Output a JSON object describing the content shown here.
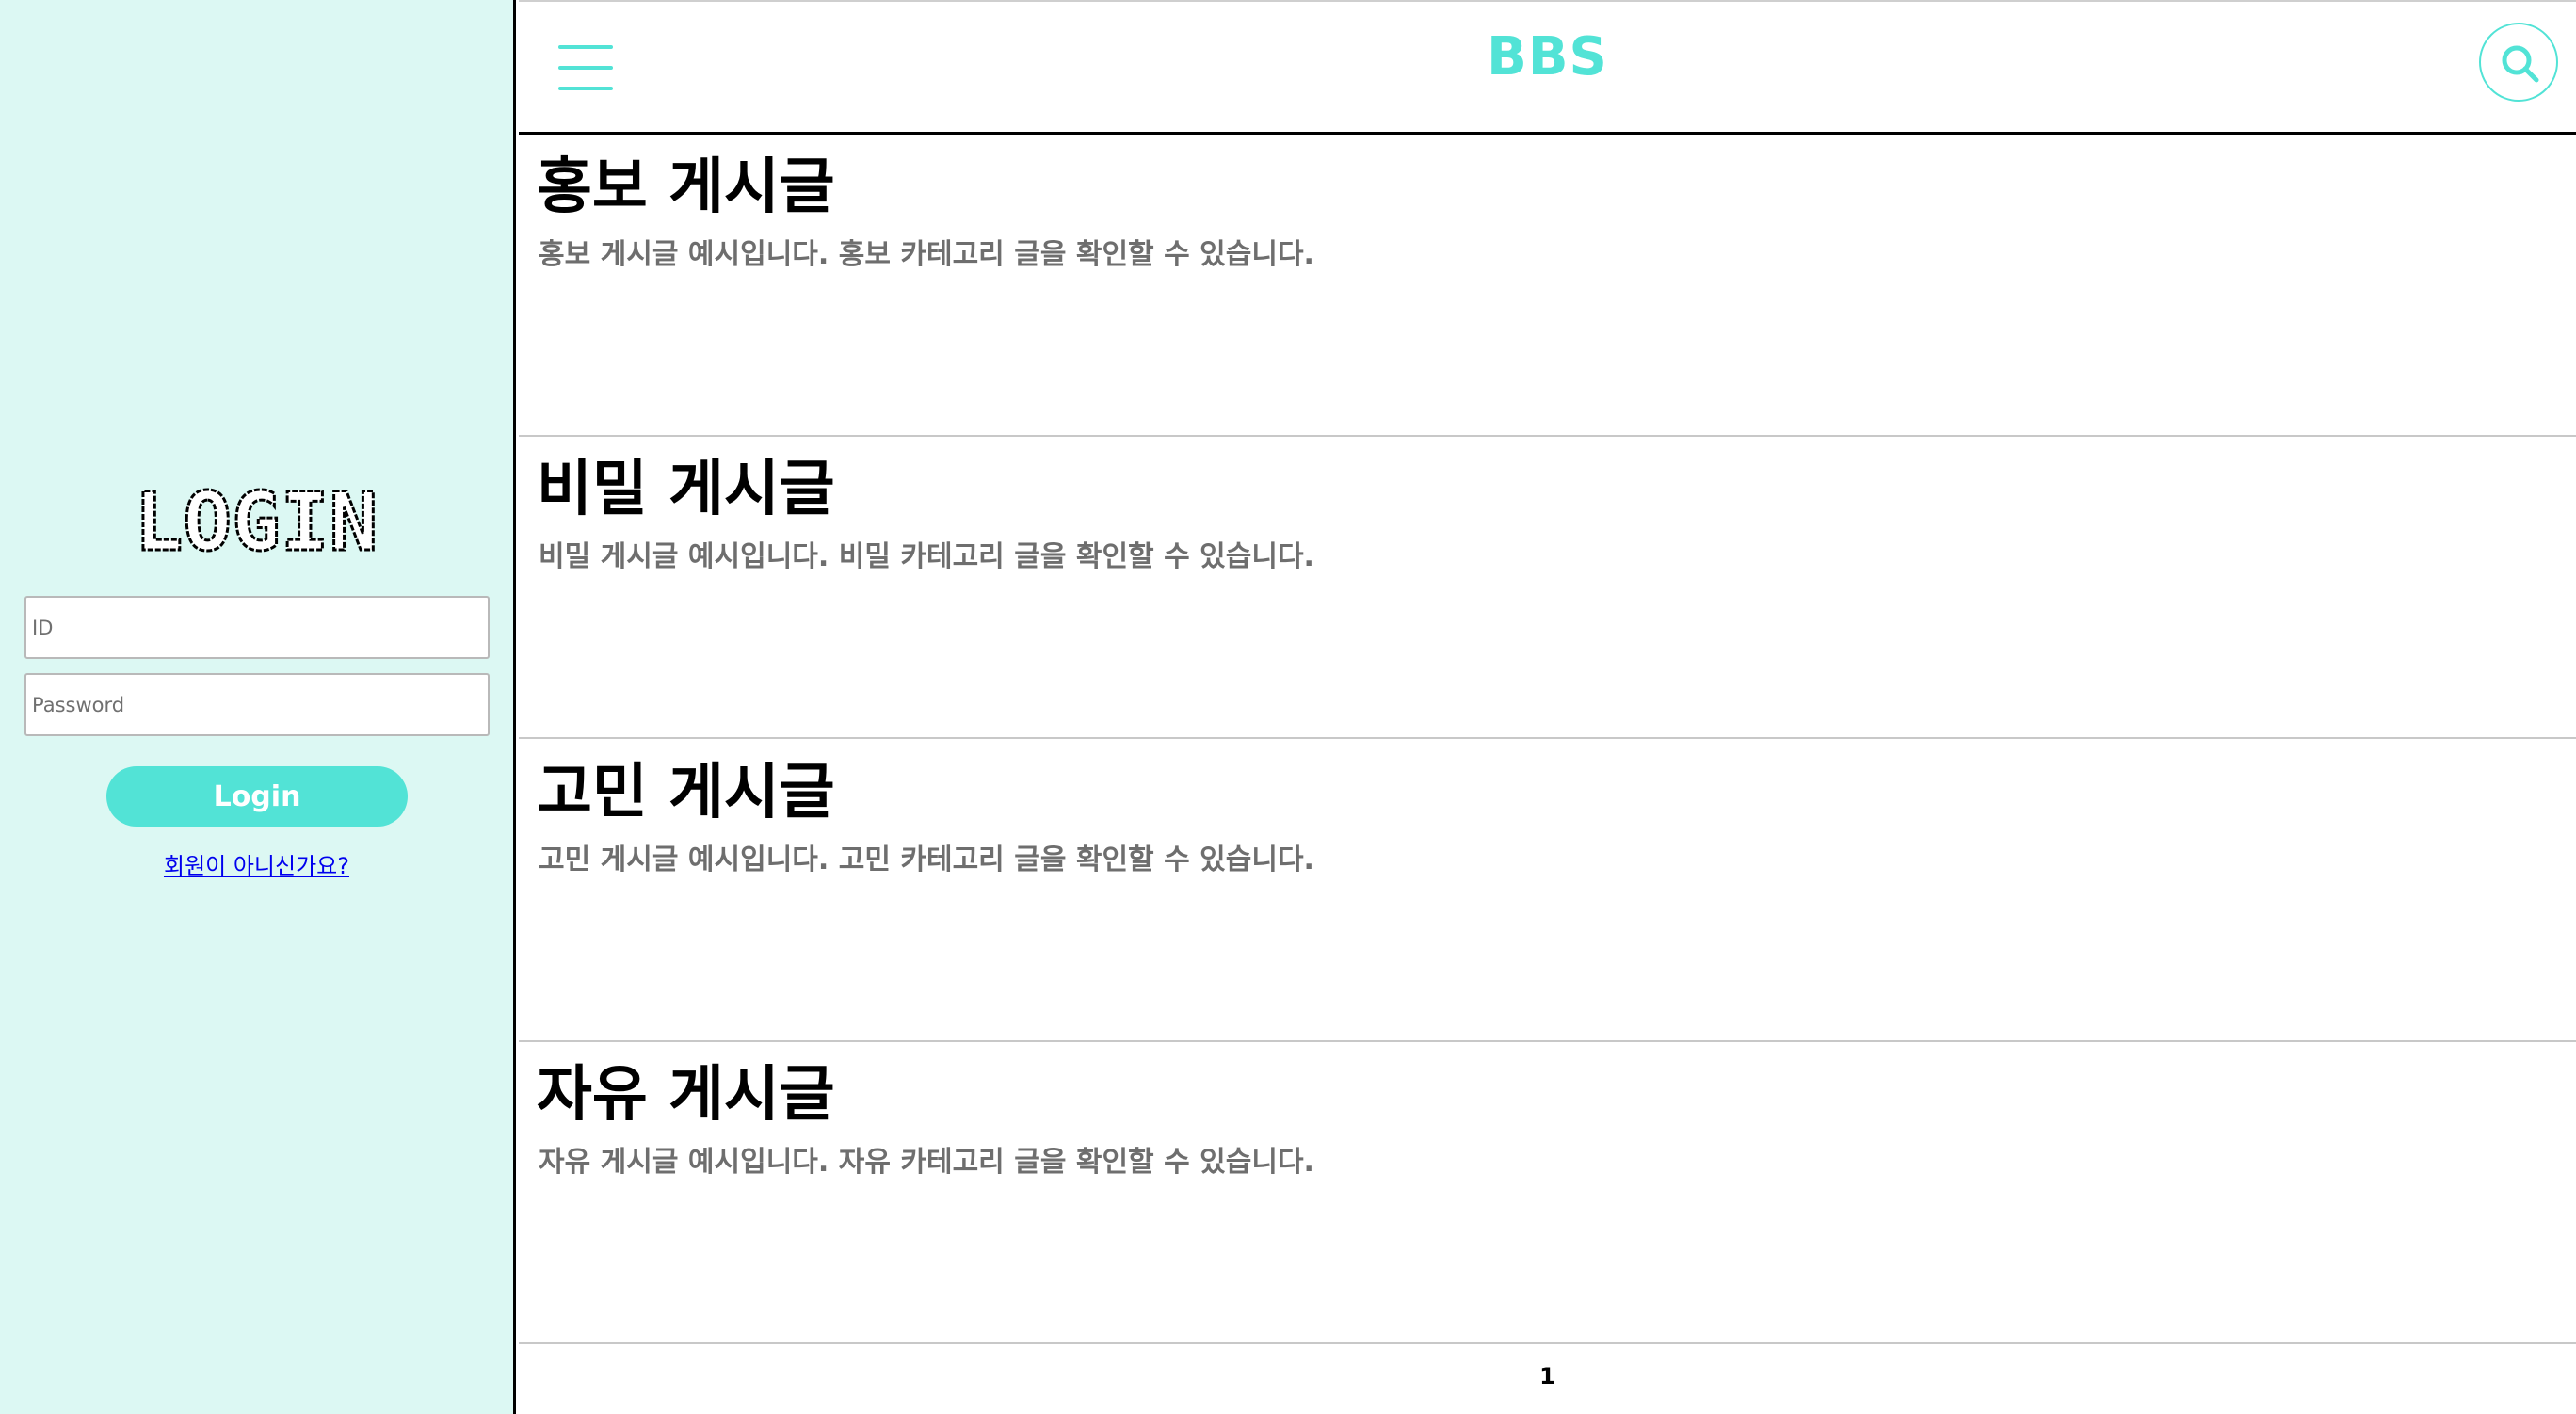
{
  "sidebar": {
    "logo_text": "LOGIN",
    "id_placeholder": "ID",
    "password_placeholder": "Password",
    "login_label": "Login",
    "signup_link": "회원이 아니신가요?"
  },
  "header": {
    "title": "BBS",
    "menu_icon": "hamburger-menu-icon",
    "search_icon": "search-icon"
  },
  "posts": [
    {
      "title": "홍보 게시글",
      "description": "홍보 게시글 예시입니다. 홍보 카테고리 글을 확인할 수 있습니다."
    },
    {
      "title": "비밀 게시글",
      "description": "비밀 게시글 예시입니다. 비밀 카테고리 글을 확인할 수 있습니다."
    },
    {
      "title": "고민 게시글",
      "description": "고민 게시글 예시입니다. 고민 카테고리 글을 확인할 수 있습니다."
    },
    {
      "title": "자유 게시글",
      "description": "자유 게시글 예시입니다. 자유 카테고리 글을 확인할 수 있습니다."
    }
  ],
  "pagination": {
    "current_page": "1"
  },
  "colors": {
    "accent": "#52e3d6",
    "sidebar_bg": "#dcf8f3",
    "description_text": "#6e6e6e",
    "link": "#0000ee"
  }
}
